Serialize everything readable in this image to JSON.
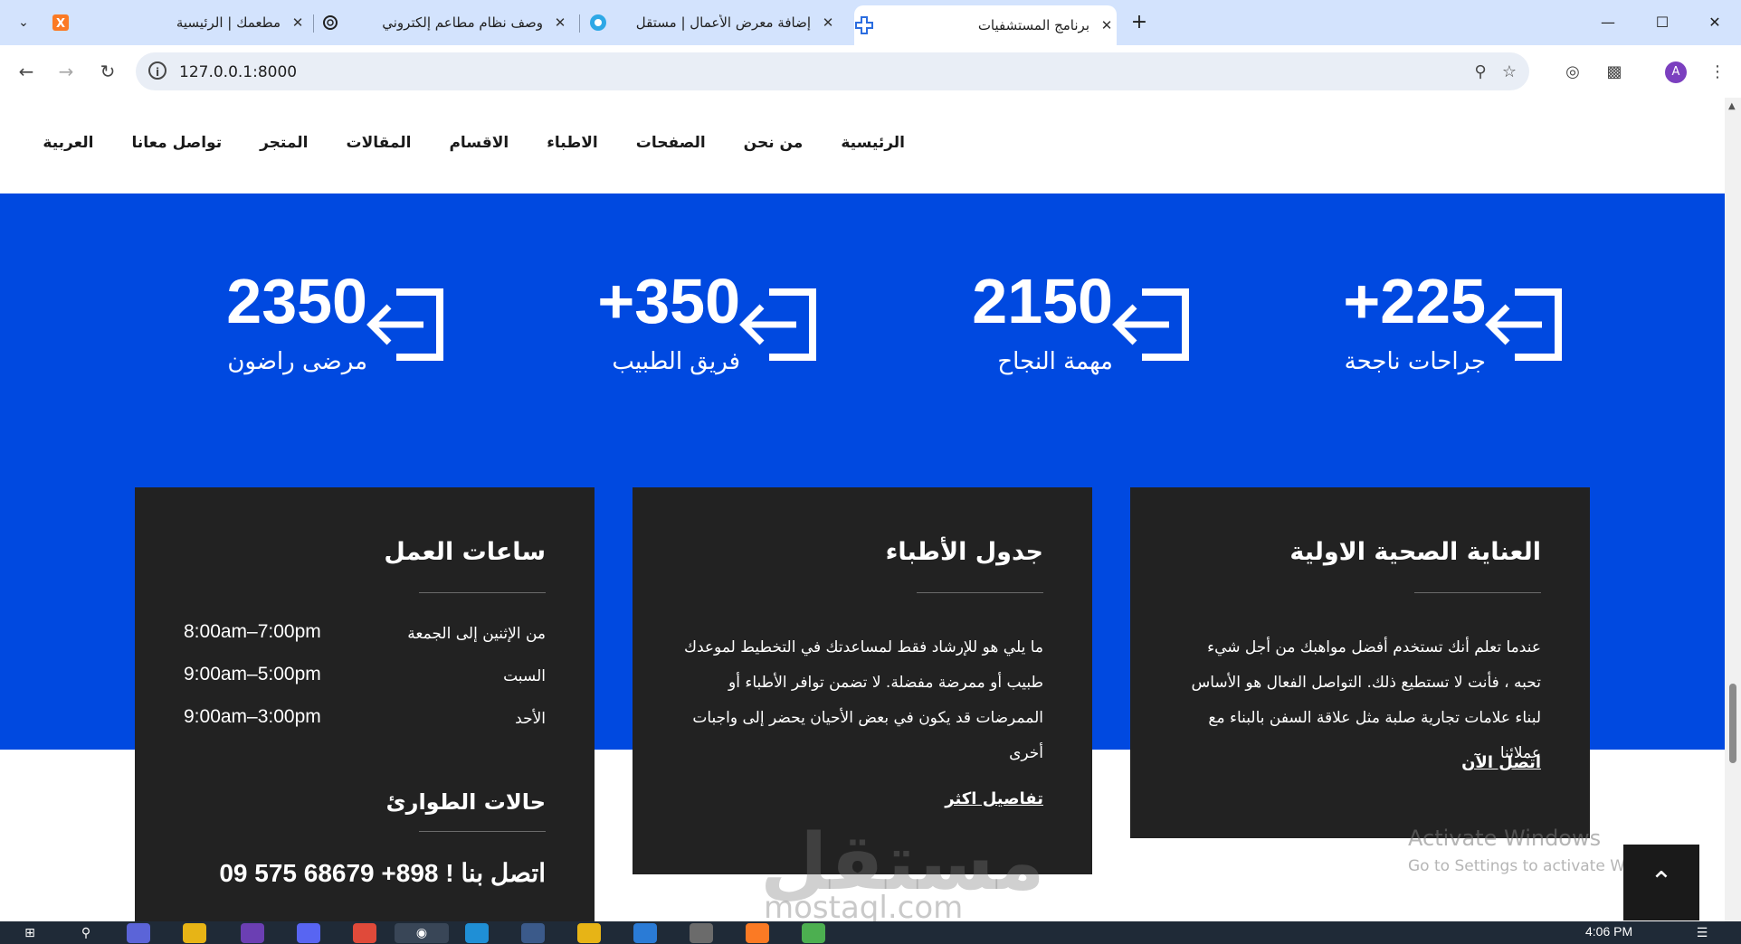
{
  "tabs": [
    {
      "title": "مطعمك | الرئيسية",
      "favicon": "xampp-icon",
      "favicon_color": "#fb7a24"
    },
    {
      "title": "وصف نظام مطاعم إلكتروني",
      "favicon": "openai-icon",
      "favicon_color": "#202020"
    },
    {
      "title": "إضافة معرض الأعمال | مستقل",
      "favicon": "mostaql-icon",
      "favicon_color": "#2ea8e6"
    },
    {
      "title": "برنامج المستشفيات",
      "favicon": "medical-cross-icon",
      "favicon_color": "#2b6de0",
      "active": true
    }
  ],
  "address": {
    "url": "127.0.0.1:8000"
  },
  "profile": {
    "initial": "A"
  },
  "nav": {
    "items": [
      "الرئيسية",
      "من نحن",
      "الصفحات",
      "الاطباء",
      "الاقسام",
      "المقالات",
      "المتجر",
      "تواصل معانا",
      "العربية"
    ]
  },
  "colors": {
    "band": "#0049e0",
    "card": "#222222"
  },
  "stats": [
    {
      "number": "+225",
      "label": "جراحات ناجحة",
      "icon": "sign-in-icon"
    },
    {
      "number": "2150",
      "label": "مهمة النجاح",
      "icon": "sign-in-icon"
    },
    {
      "number": "+350",
      "label": "فريق الطبيب",
      "icon": "sign-in-icon"
    },
    {
      "number": "2350",
      "label": "مرضى راضون",
      "icon": "sign-in-icon"
    }
  ],
  "cards": {
    "primary_care": {
      "title": "العناية الصحية الاولية",
      "body": "عندما تعلم أنك تستخدم أفضل مواهبك من أجل شيء تحبه ، فأنت لا تستطيع ذلك. التواصل الفعال هو الأساس لبناء علامات تجارية صلبة مثل علاقة السفن بالبناء مع عملائنا",
      "link": "اتصل الآن"
    },
    "doctors_schedule": {
      "title": "جدول الأطباء",
      "body": "ما يلي هو للإرشاد فقط لمساعدتك في التخطيط لموعدك طبيب أو ممرضة مفضلة. لا تضمن توافر الأطباء أو الممرضات قد يكون في بعض الأحيان يحضر إلى واجبات أخرى",
      "link": "تفاصيل اكثر"
    },
    "working_hours": {
      "title": "ساعات العمل",
      "rows": [
        {
          "day": "من الإثنين إلى الجمعة",
          "time": "8:00am–7:00pm"
        },
        {
          "day": "السبت",
          "time": "9:00am–5:00pm"
        },
        {
          "day": "الأحد",
          "time": "9:00am–3:00pm"
        }
      ],
      "emergency_title": "حالات الطوارئ",
      "phone": "اتصل بنا ! 898+ 68679 575 09"
    }
  },
  "watermark": {
    "logo": "مستقل",
    "text": "mostaql.com"
  },
  "activation": {
    "title": "Activate Windows",
    "subtitle": "Go to Settings to activate Windows."
  },
  "taskbar": {
    "time": "4:06 PM"
  }
}
